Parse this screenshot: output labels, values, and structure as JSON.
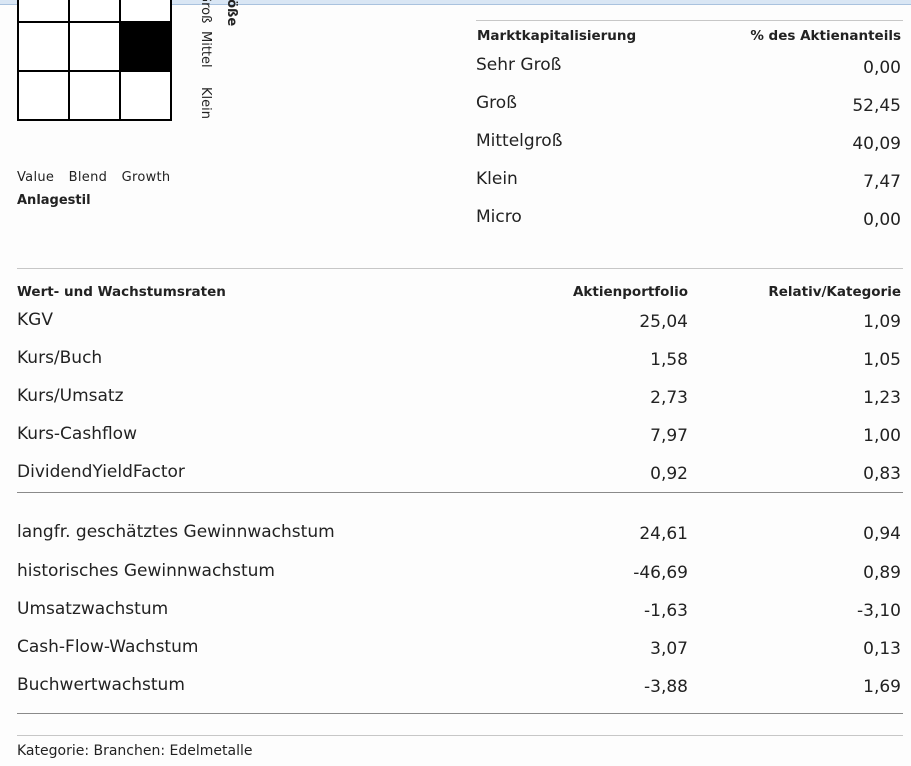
{
  "style_box": {
    "filled_cell": "middle-growth",
    "size_labels": [
      "Groß",
      "Mittel",
      "Klein"
    ],
    "size_title": "Größe",
    "style_labels": [
      "Value",
      "Blend",
      "Growth"
    ],
    "style_title": "Anlagestil"
  },
  "market_cap": {
    "header_left": "Marktkapitalisierung",
    "header_right": "% des Aktienanteils",
    "rows": [
      {
        "label": "Sehr Groß",
        "value": "0,00"
      },
      {
        "label": "Groß",
        "value": "52,45"
      },
      {
        "label": "Mittelgroß",
        "value": "40,09"
      },
      {
        "label": "Klein",
        "value": "7,47"
      },
      {
        "label": "Micro",
        "value": "0,00"
      }
    ]
  },
  "value_growth": {
    "header_label": "Wert- und Wachstumsraten",
    "header_col1": "Aktienportfolio",
    "header_col2": "Relativ/Kategorie",
    "rows_a": [
      {
        "label": "KGV",
        "portfolio": "25,04",
        "relative": "1,09"
      },
      {
        "label": "Kurs/Buch",
        "portfolio": "1,58",
        "relative": "1,05"
      },
      {
        "label": "Kurs/Umsatz",
        "portfolio": "2,73",
        "relative": "1,23"
      },
      {
        "label": "Kurs-Cashflow",
        "portfolio": "7,97",
        "relative": "1,00"
      },
      {
        "label": "DividendYieldFactor",
        "portfolio": "0,92",
        "relative": "0,83"
      }
    ],
    "rows_b": [
      {
        "label": "langfr. geschätztes Gewinnwachstum",
        "portfolio": "24,61",
        "relative": "0,94"
      },
      {
        "label": "historisches Gewinnwachstum",
        "portfolio": "-46,69",
        "relative": "0,89"
      },
      {
        "label": "Umsatzwachstum",
        "portfolio": "-1,63",
        "relative": "-3,10"
      },
      {
        "label": "Cash-Flow-Wachstum",
        "portfolio": "3,07",
        "relative": "0,13"
      },
      {
        "label": "Buchwertwachstum",
        "portfolio": "-3,88",
        "relative": "1,69"
      }
    ]
  },
  "footer": {
    "category": "Kategorie: Branchen: Edelmetalle"
  }
}
